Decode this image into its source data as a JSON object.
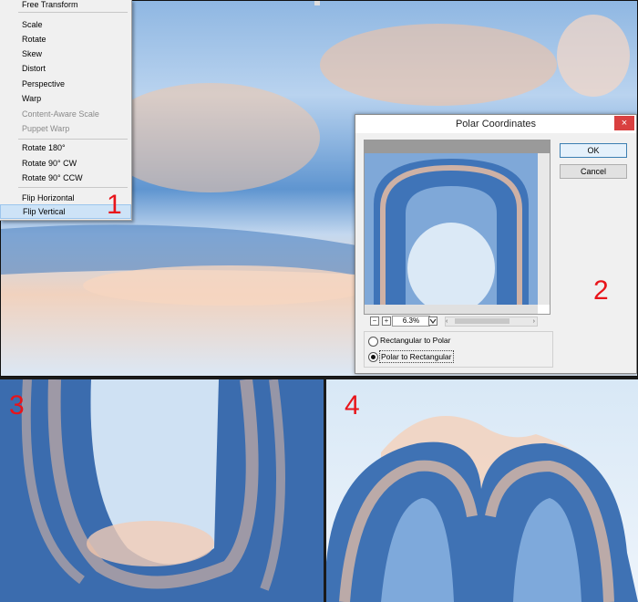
{
  "menu": {
    "items": [
      {
        "label": "Free Transform",
        "state": "normal"
      },
      {
        "label": "Scale",
        "state": "normal"
      },
      {
        "label": "Rotate",
        "state": "normal"
      },
      {
        "label": "Skew",
        "state": "normal"
      },
      {
        "label": "Distort",
        "state": "normal"
      },
      {
        "label": "Perspective",
        "state": "normal"
      },
      {
        "label": "Warp",
        "state": "normal"
      },
      {
        "label": "Content-Aware Scale",
        "state": "disabled"
      },
      {
        "label": "Puppet Warp",
        "state": "disabled"
      },
      {
        "label": "Rotate 180°",
        "state": "normal"
      },
      {
        "label": "Rotate 90° CW",
        "state": "normal"
      },
      {
        "label": "Rotate 90° CCW",
        "state": "normal"
      },
      {
        "label": "Flip Horizontal",
        "state": "normal"
      },
      {
        "label": "Flip Vertical",
        "state": "highlighted"
      }
    ]
  },
  "dialog": {
    "title": "Polar Coordinates",
    "close_glyph": "×",
    "ok_label": "OK",
    "cancel_label": "Cancel",
    "zoom_value": "6.3%",
    "zoom_out_glyph": "−",
    "zoom_in_glyph": "+",
    "options": [
      {
        "label": "Rectangular to Polar",
        "selected": false
      },
      {
        "label": "Polar to Rectangular",
        "selected": true
      }
    ]
  },
  "steps": {
    "s1": "1",
    "s2": "2",
    "s3": "3",
    "s4": "4"
  },
  "colors": {
    "step_red": "#e8141a",
    "snow_blue": "#3f7cc4",
    "frost_peach": "#f2c0a0",
    "sky_pale": "#dce9f5",
    "highlight": "#cde3f7"
  }
}
